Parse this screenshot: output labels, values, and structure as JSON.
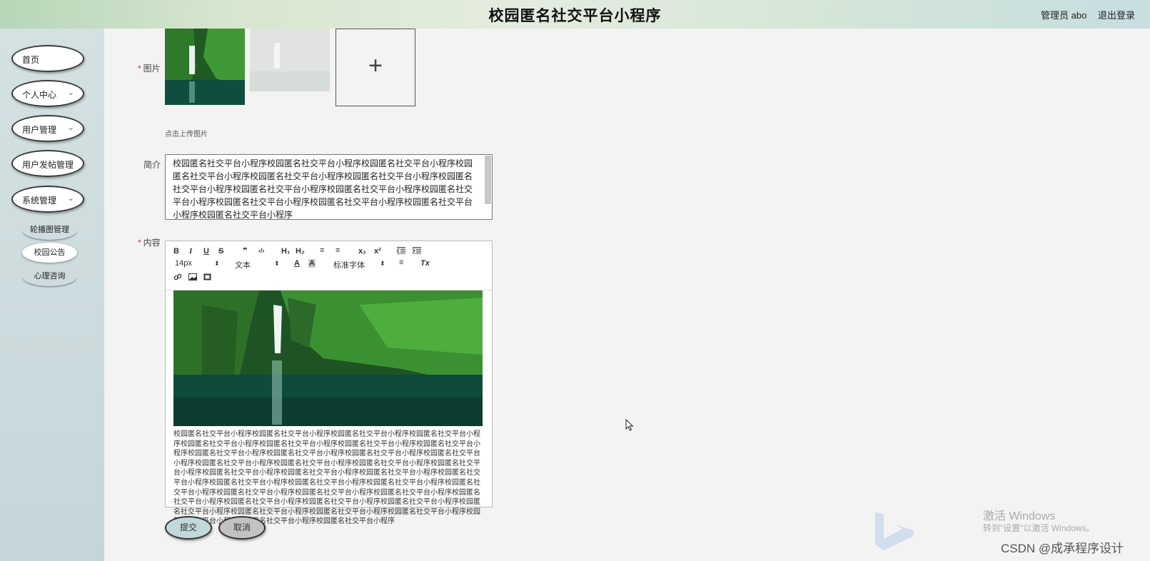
{
  "header": {
    "title": "校园匿名社交平台小程序",
    "user": "管理员 abo",
    "logout": "退出登录"
  },
  "sidebar": {
    "items": [
      {
        "label": "首页",
        "chevron": ""
      },
      {
        "label": "个人中心",
        "chevron": "⌄"
      },
      {
        "label": "用户管理",
        "chevron": "⌄"
      },
      {
        "label": "用户发帖管理",
        "chevron": "⌄"
      },
      {
        "label": "系统管理",
        "chevron": "⌄"
      }
    ],
    "sub_items": [
      "轮播图管理",
      "校园公告",
      "心理咨询"
    ]
  },
  "form": {
    "image_label": "图片",
    "upload_plus": "+",
    "upload_tip": "点击上传图片",
    "intro_label": "简介",
    "intro_value": "校园匿名社交平台小程序校园匿名社交平台小程序校园匿名社交平台小程序校园匿名社交平台小程序校园匿名社交平台小程序校园匿名社交平台小程序校园匿名社交平台小程序校园匿名社交平台小程序校园匿名社交平台小程序校园匿名社交平台小程序校园匿名社交平台小程序校园匿名社交平台小程序校园匿名社交平台小程序校园匿名社交平台小程序",
    "content_label": "内容",
    "editor_text": "校园匿名社交平台小程序校园匿名社交平台小程序校园匿名社交平台小程序校园匿名社交平台小程序校园匿名社交平台小程序校园匿名社交平台小程序校园匿名社交平台小程序校园匿名社交平台小程序校园匿名社交平台小程序校园匿名社交平台小程序校园匿名社交平台小程序校园匿名社交平台小程序校园匿名社交平台小程序校园匿名社交平台小程序校园匿名社交平台小程序校园匿名社交平台小程序校园匿名社交平台小程序校园匿名社交平台小程序校园匿名社交平台小程序校园匿名社交平台小程序校园匿名社交平台小程序校园匿名社交平台小程序校园匿名社交平台小程序校园匿名社交平台小程序校园匿名社交平台小程序校园匿名社交平台小程序校园匿名社交平台小程序校园匿名社交平台小程序校园匿名社交平台小程序校园匿名社交平台小程序校园匿名社交平台小程序校园匿名社交平台小程序校园匿名社交平台小程序校园匿名社交平台小程序校园匿名社交平台小程序校园匿名社交平台小程序校园匿名社交平台小程序校园匿名社交平台小程序",
    "submit": "提交",
    "cancel": "取消"
  },
  "toolbar": {
    "bold": "B",
    "italic": "I",
    "underline": "U",
    "strike": "S",
    "quote": "❞",
    "code": "‹/›",
    "h1": "H₁",
    "h2": "H₂",
    "ordered_list": "≡",
    "bullet_list": "≡",
    "subscript": "x₂",
    "superscript": "x²",
    "font_size": "14px",
    "block_type": "文本",
    "font_family": "标准字体",
    "text_color": "A",
    "bg_color": "A",
    "align": "≡",
    "clear": "Tx"
  },
  "watermark": {
    "line1": "激活 Windows",
    "line2": "转到\"设置\"以激活 Windows。",
    "csdn": "CSDN @成承程序设计"
  },
  "colors": {
    "sidebar_bg": "#c6d6d8",
    "submit_bg": "#c3d8da",
    "cancel_bg": "#c2c2c2",
    "required": "#ee2233"
  }
}
